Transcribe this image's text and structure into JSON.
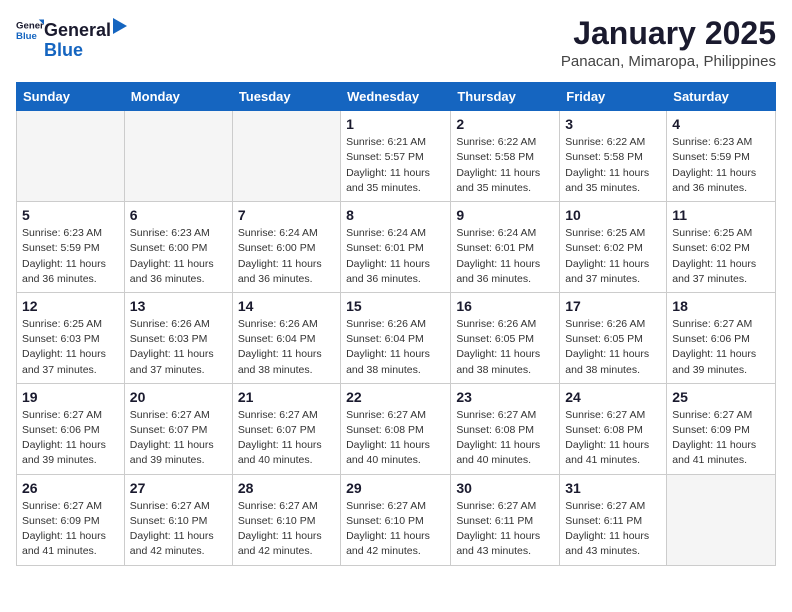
{
  "logo": {
    "general": "General",
    "blue": "Blue"
  },
  "title": "January 2025",
  "subtitle": "Panacan, Mimaropa, Philippines",
  "days_of_week": [
    "Sunday",
    "Monday",
    "Tuesday",
    "Wednesday",
    "Thursday",
    "Friday",
    "Saturday"
  ],
  "weeks": [
    [
      {
        "day": "",
        "sunrise": "",
        "sunset": "",
        "daylight": ""
      },
      {
        "day": "",
        "sunrise": "",
        "sunset": "",
        "daylight": ""
      },
      {
        "day": "",
        "sunrise": "",
        "sunset": "",
        "daylight": ""
      },
      {
        "day": "1",
        "sunrise": "Sunrise: 6:21 AM",
        "sunset": "Sunset: 5:57 PM",
        "daylight": "Daylight: 11 hours and 35 minutes."
      },
      {
        "day": "2",
        "sunrise": "Sunrise: 6:22 AM",
        "sunset": "Sunset: 5:58 PM",
        "daylight": "Daylight: 11 hours and 35 minutes."
      },
      {
        "day": "3",
        "sunrise": "Sunrise: 6:22 AM",
        "sunset": "Sunset: 5:58 PM",
        "daylight": "Daylight: 11 hours and 35 minutes."
      },
      {
        "day": "4",
        "sunrise": "Sunrise: 6:23 AM",
        "sunset": "Sunset: 5:59 PM",
        "daylight": "Daylight: 11 hours and 36 minutes."
      }
    ],
    [
      {
        "day": "5",
        "sunrise": "Sunrise: 6:23 AM",
        "sunset": "Sunset: 5:59 PM",
        "daylight": "Daylight: 11 hours and 36 minutes."
      },
      {
        "day": "6",
        "sunrise": "Sunrise: 6:23 AM",
        "sunset": "Sunset: 6:00 PM",
        "daylight": "Daylight: 11 hours and 36 minutes."
      },
      {
        "day": "7",
        "sunrise": "Sunrise: 6:24 AM",
        "sunset": "Sunset: 6:00 PM",
        "daylight": "Daylight: 11 hours and 36 minutes."
      },
      {
        "day": "8",
        "sunrise": "Sunrise: 6:24 AM",
        "sunset": "Sunset: 6:01 PM",
        "daylight": "Daylight: 11 hours and 36 minutes."
      },
      {
        "day": "9",
        "sunrise": "Sunrise: 6:24 AM",
        "sunset": "Sunset: 6:01 PM",
        "daylight": "Daylight: 11 hours and 36 minutes."
      },
      {
        "day": "10",
        "sunrise": "Sunrise: 6:25 AM",
        "sunset": "Sunset: 6:02 PM",
        "daylight": "Daylight: 11 hours and 37 minutes."
      },
      {
        "day": "11",
        "sunrise": "Sunrise: 6:25 AM",
        "sunset": "Sunset: 6:02 PM",
        "daylight": "Daylight: 11 hours and 37 minutes."
      }
    ],
    [
      {
        "day": "12",
        "sunrise": "Sunrise: 6:25 AM",
        "sunset": "Sunset: 6:03 PM",
        "daylight": "Daylight: 11 hours and 37 minutes."
      },
      {
        "day": "13",
        "sunrise": "Sunrise: 6:26 AM",
        "sunset": "Sunset: 6:03 PM",
        "daylight": "Daylight: 11 hours and 37 minutes."
      },
      {
        "day": "14",
        "sunrise": "Sunrise: 6:26 AM",
        "sunset": "Sunset: 6:04 PM",
        "daylight": "Daylight: 11 hours and 38 minutes."
      },
      {
        "day": "15",
        "sunrise": "Sunrise: 6:26 AM",
        "sunset": "Sunset: 6:04 PM",
        "daylight": "Daylight: 11 hours and 38 minutes."
      },
      {
        "day": "16",
        "sunrise": "Sunrise: 6:26 AM",
        "sunset": "Sunset: 6:05 PM",
        "daylight": "Daylight: 11 hours and 38 minutes."
      },
      {
        "day": "17",
        "sunrise": "Sunrise: 6:26 AM",
        "sunset": "Sunset: 6:05 PM",
        "daylight": "Daylight: 11 hours and 38 minutes."
      },
      {
        "day": "18",
        "sunrise": "Sunrise: 6:27 AM",
        "sunset": "Sunset: 6:06 PM",
        "daylight": "Daylight: 11 hours and 39 minutes."
      }
    ],
    [
      {
        "day": "19",
        "sunrise": "Sunrise: 6:27 AM",
        "sunset": "Sunset: 6:06 PM",
        "daylight": "Daylight: 11 hours and 39 minutes."
      },
      {
        "day": "20",
        "sunrise": "Sunrise: 6:27 AM",
        "sunset": "Sunset: 6:07 PM",
        "daylight": "Daylight: 11 hours and 39 minutes."
      },
      {
        "day": "21",
        "sunrise": "Sunrise: 6:27 AM",
        "sunset": "Sunset: 6:07 PM",
        "daylight": "Daylight: 11 hours and 40 minutes."
      },
      {
        "day": "22",
        "sunrise": "Sunrise: 6:27 AM",
        "sunset": "Sunset: 6:08 PM",
        "daylight": "Daylight: 11 hours and 40 minutes."
      },
      {
        "day": "23",
        "sunrise": "Sunrise: 6:27 AM",
        "sunset": "Sunset: 6:08 PM",
        "daylight": "Daylight: 11 hours and 40 minutes."
      },
      {
        "day": "24",
        "sunrise": "Sunrise: 6:27 AM",
        "sunset": "Sunset: 6:08 PM",
        "daylight": "Daylight: 11 hours and 41 minutes."
      },
      {
        "day": "25",
        "sunrise": "Sunrise: 6:27 AM",
        "sunset": "Sunset: 6:09 PM",
        "daylight": "Daylight: 11 hours and 41 minutes."
      }
    ],
    [
      {
        "day": "26",
        "sunrise": "Sunrise: 6:27 AM",
        "sunset": "Sunset: 6:09 PM",
        "daylight": "Daylight: 11 hours and 41 minutes."
      },
      {
        "day": "27",
        "sunrise": "Sunrise: 6:27 AM",
        "sunset": "Sunset: 6:10 PM",
        "daylight": "Daylight: 11 hours and 42 minutes."
      },
      {
        "day": "28",
        "sunrise": "Sunrise: 6:27 AM",
        "sunset": "Sunset: 6:10 PM",
        "daylight": "Daylight: 11 hours and 42 minutes."
      },
      {
        "day": "29",
        "sunrise": "Sunrise: 6:27 AM",
        "sunset": "Sunset: 6:10 PM",
        "daylight": "Daylight: 11 hours and 42 minutes."
      },
      {
        "day": "30",
        "sunrise": "Sunrise: 6:27 AM",
        "sunset": "Sunset: 6:11 PM",
        "daylight": "Daylight: 11 hours and 43 minutes."
      },
      {
        "day": "31",
        "sunrise": "Sunrise: 6:27 AM",
        "sunset": "Sunset: 6:11 PM",
        "daylight": "Daylight: 11 hours and 43 minutes."
      },
      {
        "day": "",
        "sunrise": "",
        "sunset": "",
        "daylight": ""
      }
    ]
  ]
}
